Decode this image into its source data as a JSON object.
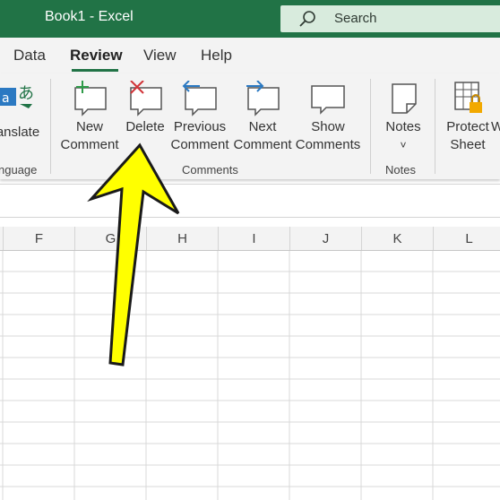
{
  "window": {
    "title": "Book1  -  Excel"
  },
  "search": {
    "placeholder": "Search",
    "icon": "search-icon"
  },
  "tabs": [
    {
      "label": "Data"
    },
    {
      "label": "Review",
      "active": true
    },
    {
      "label": "View"
    },
    {
      "label": "Help"
    }
  ],
  "ribbon": {
    "language": {
      "translate_label": "anslate",
      "group_label": "nguage"
    },
    "comments": {
      "new_line1": "New",
      "new_line2": "Comment",
      "delete_label": "Delete",
      "previous_line1": "Previous",
      "previous_line2": "Comment",
      "next_line1": "Next",
      "next_line2": "Comment",
      "show_line1": "Show",
      "show_line2": "Comments",
      "group_label": "Comments"
    },
    "notes": {
      "label": "Notes",
      "dropdown_glyph": "˅",
      "group_label": "Notes"
    },
    "protect": {
      "line1": "Protect",
      "line2": "Sheet",
      "next_partial": "W"
    }
  },
  "columns": [
    "F",
    "G",
    "H",
    "I",
    "J",
    "K",
    "L"
  ],
  "colors": {
    "brand": "#217346",
    "ribbon_bg": "#f3f3f3",
    "arrow": "#ffff00"
  }
}
